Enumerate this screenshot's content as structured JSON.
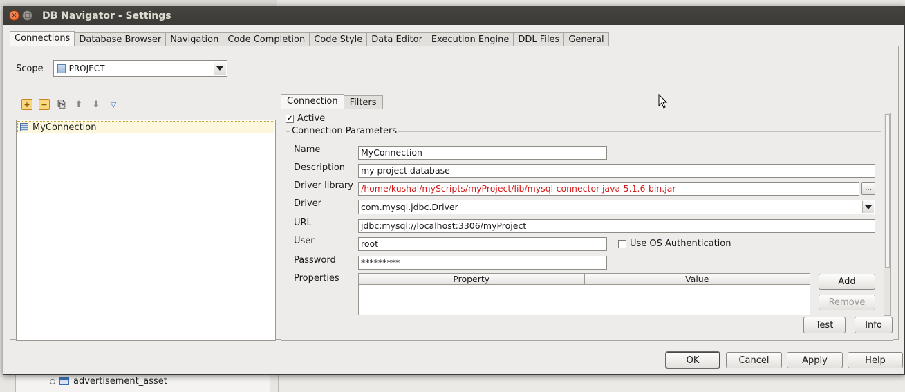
{
  "window": {
    "title": "DB Navigator - Settings"
  },
  "tabs": [
    "Connections",
    "Database Browser",
    "Navigation",
    "Code Completion",
    "Code Style",
    "Data Editor",
    "Execution Engine",
    "DDL Files",
    "General"
  ],
  "scope": {
    "label": "Scope",
    "value": "PROJECT"
  },
  "toolbar": {
    "icons": [
      "add-icon",
      "remove-icon",
      "copy-icon",
      "move-up-icon",
      "move-down-icon",
      "filter-icon"
    ]
  },
  "connections_list": {
    "items": [
      "MyConnection"
    ]
  },
  "detail_tabs": [
    "Connection",
    "Filters"
  ],
  "active": {
    "label": "Active",
    "checked": true
  },
  "params": {
    "legend": "Connection Parameters",
    "name_label": "Name",
    "name_value": "MyConnection",
    "description_label": "Description",
    "description_value": "my project database",
    "driver_library_label": "Driver library",
    "driver_library_value": "/home/kushal/myScripts/myProject/lib/mysql-connector-java-5.1.6-bin.jar",
    "browse_label": "...",
    "driver_label": "Driver",
    "driver_value": "com.mysql.jdbc.Driver",
    "url_label": "URL",
    "url_value": "jdbc:mysql://localhost:3306/myProject",
    "user_label": "User",
    "user_value": "root",
    "os_auth_label": "Use OS Authentication",
    "os_auth_checked": false,
    "password_label": "Password",
    "password_value": "*********",
    "properties_label": "Properties",
    "properties_columns": [
      "Property",
      "Value"
    ],
    "add_label": "Add",
    "remove_label": "Remove"
  },
  "panel_buttons": {
    "test": "Test",
    "info": "Info"
  },
  "footer_buttons": {
    "ok": "OK",
    "cancel": "Cancel",
    "apply": "Apply",
    "help": "Help"
  },
  "background": {
    "tree_item": "advertisement_asset"
  }
}
